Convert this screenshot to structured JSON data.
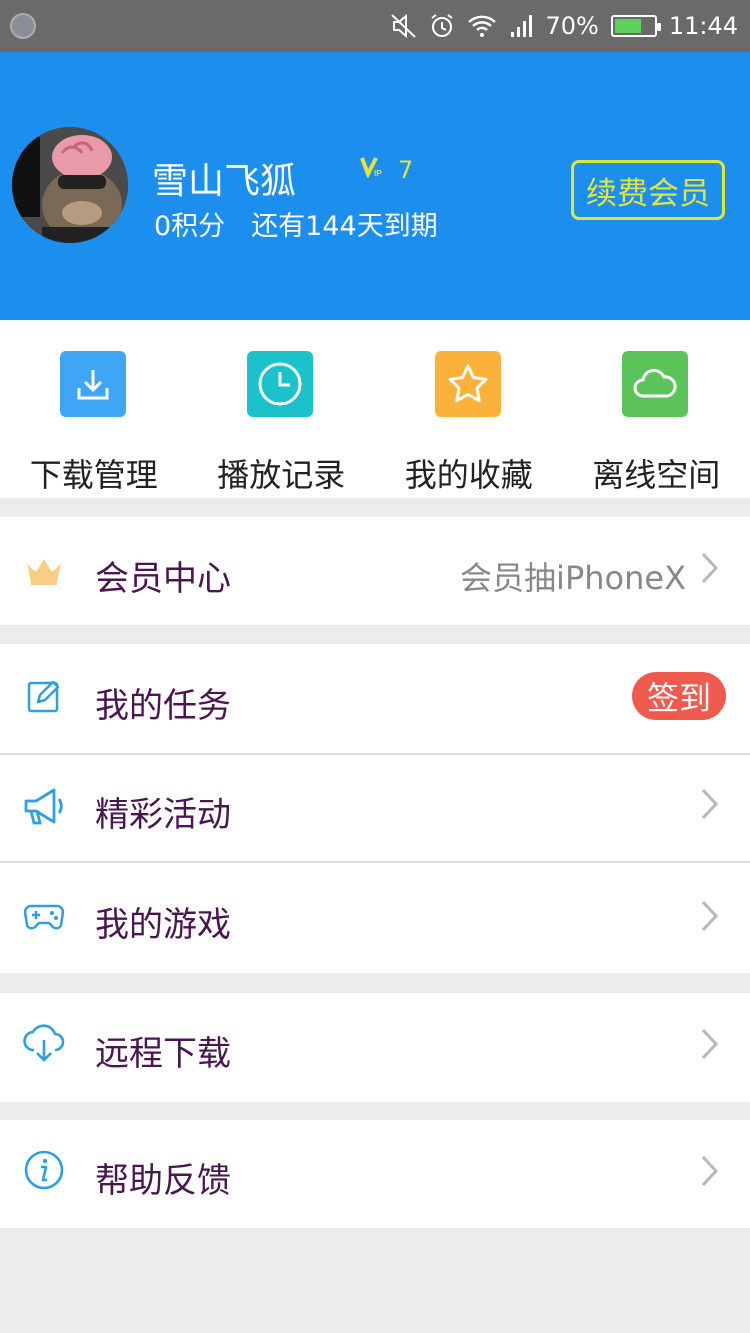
{
  "status_bar": {
    "battery": "70%",
    "battery_level": 0.7,
    "time": "11:44"
  },
  "profile": {
    "username": "雪山飞狐",
    "vip_level": "7",
    "points": "0积分",
    "expiry": "还有144天到期",
    "renew_label": "续费会员"
  },
  "quick_actions": [
    {
      "label": "下载管理",
      "icon": "download-icon",
      "color": "#3fa6f5"
    },
    {
      "label": "播放记录",
      "icon": "clock-icon",
      "color": "#1cc2c9"
    },
    {
      "label": "我的收藏",
      "icon": "star-icon",
      "color": "#fbb13a"
    },
    {
      "label": "离线空间",
      "icon": "cloud-icon",
      "color": "#5cc35a"
    }
  ],
  "menu": {
    "member_center": {
      "label": "会员中心",
      "value": "会员抽iPhoneX",
      "icon": "crown-icon"
    },
    "tasks": {
      "label": "我的任务",
      "badge": "签到",
      "icon": "edit-icon"
    },
    "events": {
      "label": "精彩活动",
      "icon": "megaphone-icon"
    },
    "games": {
      "label": "我的游戏",
      "icon": "gamepad-icon"
    },
    "remote_download": {
      "label": "远程下载",
      "icon": "cloud-download-icon"
    },
    "help": {
      "label": "帮助反馈",
      "icon": "info-icon"
    }
  },
  "colors": {
    "header_bg": "#1c8fee",
    "accent_yellow": "#e0e53a",
    "badge_red": "#ef5a4c",
    "label_purple": "#4a1650",
    "icon_blue": "#2e9fe0"
  }
}
